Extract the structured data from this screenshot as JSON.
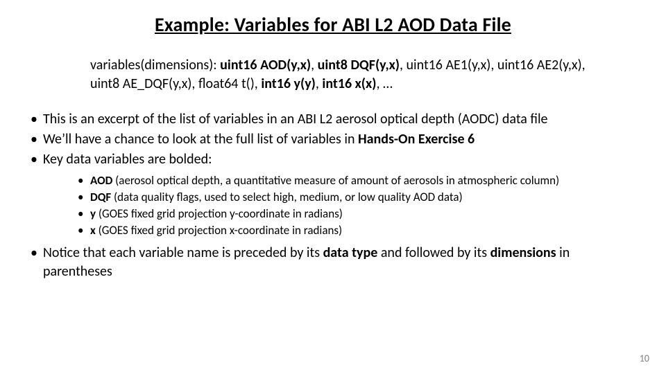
{
  "title": "Example: Variables for ABI L2 AOD Data File",
  "vars_prefix": "variables(dimensions): ",
  "vars_items": [
    {
      "text": "uint16 AOD(y,x)",
      "bold": true
    },
    {
      "text": ", ",
      "bold": false
    },
    {
      "text": "uint8 DQF(y,x)",
      "bold": true
    },
    {
      "text": ", uint16 AE1(y,x), uint16 AE2(y,x), uint8 AE_DQF(y,x), float64 t(), ",
      "bold": false
    },
    {
      "text": "int16 y(y)",
      "bold": true
    },
    {
      "text": ", ",
      "bold": false
    },
    {
      "text": "int16 x(x)",
      "bold": true
    },
    {
      "text": ", …",
      "bold": false
    }
  ],
  "b1": "This is an excerpt of the list of variables in an ABI L2 aerosol optical depth (AODC) data file",
  "b2_pre": "We’ll have a chance to look at the full list of variables in ",
  "b2_bold": "Hands-On Exercise 6",
  "b3": "Key data variables are bolded:",
  "sub": [
    {
      "bold": "AOD",
      "rest": " (aerosol optical depth, a quantitative measure of amount of aerosols in atmospheric column)"
    },
    {
      "bold": "DQF",
      "rest": " (data quality flags, used to select high, medium, or low quality AOD data)"
    },
    {
      "bold": "y",
      "rest": " (GOES fixed grid projection y-coordinate in radians)"
    },
    {
      "bold": "x",
      "rest": " (GOES fixed grid projection x-coordinate in radians)"
    }
  ],
  "b4_pre": "Notice that each variable name is preceded by its ",
  "b4_bold1": "data type",
  "b4_mid": " and followed by its ",
  "b4_bold2": "dimensions",
  "b4_post": " in parentheses",
  "page_number": "10"
}
